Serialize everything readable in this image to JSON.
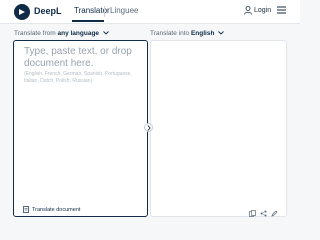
{
  "header": {
    "brand": "DeepL",
    "tabs": [
      {
        "label": "Translator",
        "active": true
      },
      {
        "label": "Linguee",
        "active": false
      }
    ],
    "login_label": "Login"
  },
  "source": {
    "prefix": "Translate from",
    "language": "any language",
    "placeholder": "Type, paste text, or drop document here.",
    "languages_hint": "(English, French, German, Spanish, Portuguese, Italian, Dutch, Polish, Russian)",
    "translate_document_label": "Translate document"
  },
  "target": {
    "prefix": "Translate into",
    "language": "English"
  },
  "colors": {
    "brand": "#0f2b46",
    "background": "#f6f7f8"
  },
  "icons": [
    "deepl-logo-icon",
    "user-icon",
    "hamburger-menu-icon",
    "chevron-down-icon",
    "document-icon",
    "swap-arrow-icon",
    "copy-icon",
    "share-icon",
    "edit-icon"
  ]
}
